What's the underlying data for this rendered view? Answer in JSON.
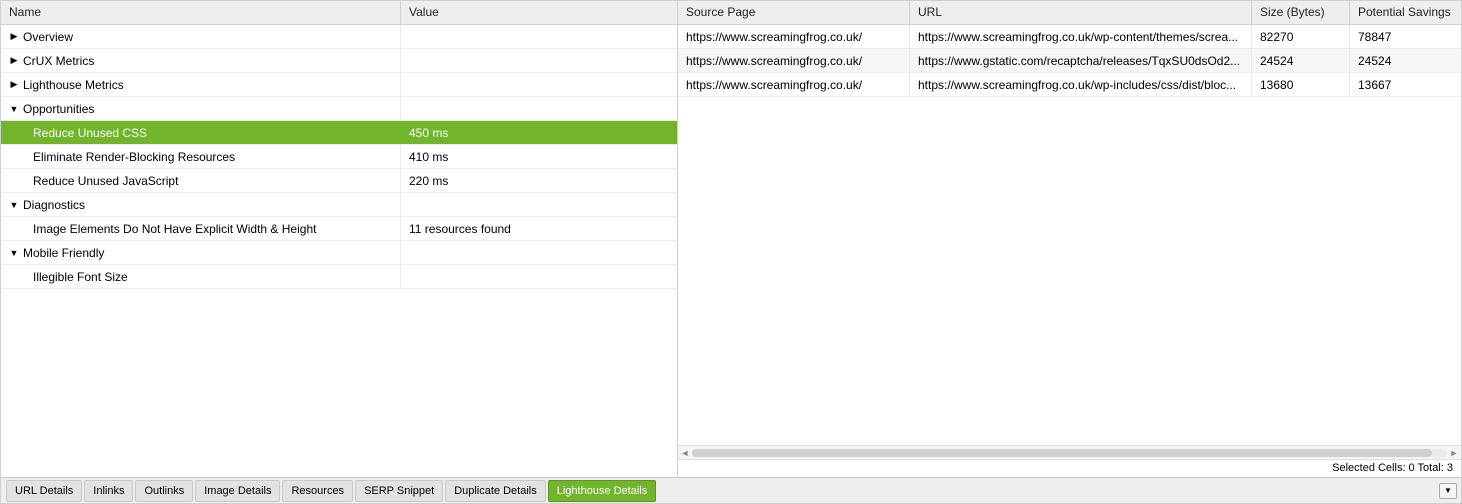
{
  "leftPanel": {
    "headers": {
      "name": "Name",
      "value": "Value"
    },
    "rows": [
      {
        "type": "group",
        "expanded": false,
        "label": "Overview",
        "value": ""
      },
      {
        "type": "group",
        "expanded": false,
        "label": "CrUX Metrics",
        "value": ""
      },
      {
        "type": "group",
        "expanded": false,
        "label": "Lighthouse Metrics",
        "value": ""
      },
      {
        "type": "group",
        "expanded": true,
        "label": "Opportunities",
        "value": ""
      },
      {
        "type": "item",
        "selected": true,
        "label": "Reduce Unused CSS",
        "value": "450 ms"
      },
      {
        "type": "item",
        "selected": false,
        "label": "Eliminate Render-Blocking Resources",
        "value": "410 ms"
      },
      {
        "type": "item",
        "selected": false,
        "label": "Reduce Unused JavaScript",
        "value": "220 ms"
      },
      {
        "type": "group",
        "expanded": true,
        "label": "Diagnostics",
        "value": ""
      },
      {
        "type": "item",
        "selected": false,
        "label": "Image Elements Do Not Have Explicit Width & Height",
        "value": "11 resources found"
      },
      {
        "type": "group",
        "expanded": true,
        "label": "Mobile Friendly",
        "value": ""
      },
      {
        "type": "item",
        "selected": false,
        "label": "Illegible Font Size",
        "value": ""
      }
    ]
  },
  "rightPanel": {
    "headers": {
      "sourcePage": "Source Page",
      "url": "URL",
      "size": "Size (Bytes)",
      "potential": "Potential Savings"
    },
    "rows": [
      {
        "sourcePage": "https://www.screamingfrog.co.uk/",
        "url": "https://www.screamingfrog.co.uk/wp-content/themes/screa...",
        "size": "82270",
        "potential": "78847"
      },
      {
        "sourcePage": "https://www.screamingfrog.co.uk/",
        "url": "https://www.gstatic.com/recaptcha/releases/TqxSU0dsOd2...",
        "size": "24524",
        "potential": "24524"
      },
      {
        "sourcePage": "https://www.screamingfrog.co.uk/",
        "url": "https://www.screamingfrog.co.uk/wp-includes/css/dist/bloc...",
        "size": "13680",
        "potential": "13667"
      }
    ],
    "status": "Selected Cells: 0  Total: 3"
  },
  "tabs": [
    {
      "label": "URL Details",
      "active": false
    },
    {
      "label": "Inlinks",
      "active": false
    },
    {
      "label": "Outlinks",
      "active": false
    },
    {
      "label": "Image Details",
      "active": false
    },
    {
      "label": "Resources",
      "active": false
    },
    {
      "label": "SERP Snippet",
      "active": false
    },
    {
      "label": "Duplicate Details",
      "active": false
    },
    {
      "label": "Lighthouse Details",
      "active": true
    }
  ]
}
